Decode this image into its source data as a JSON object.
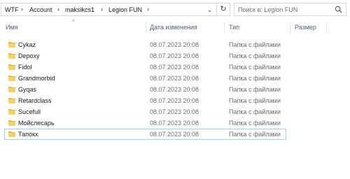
{
  "address_bar": {
    "crumbs": [
      "WTF",
      "Account",
      "maksikcs1",
      "Legion FUN"
    ]
  },
  "search": {
    "placeholder": "Поиск в: Legion FUN"
  },
  "columns": {
    "name": "Имя",
    "date": "Дата изменения",
    "type": "Тип",
    "size": "Размер"
  },
  "sorted_column": "name",
  "rows": [
    {
      "name": "Cykaz",
      "date": "08.07.2023 20:08",
      "type": "Папка с файлами",
      "size": ""
    },
    {
      "name": "Depoxy",
      "date": "08.07.2023 20:08",
      "type": "Папка с файлами",
      "size": ""
    },
    {
      "name": "Fidol",
      "date": "08.07.2023 20:08",
      "type": "Папка с файлами",
      "size": ""
    },
    {
      "name": "Grandmorbid",
      "date": "08.07.2023 20:08",
      "type": "Папка с файлами",
      "size": ""
    },
    {
      "name": "Gyqas",
      "date": "08.07.2023 20:08",
      "type": "Папка с файлами",
      "size": ""
    },
    {
      "name": "Retardclass",
      "date": "08.07.2023 20:08",
      "type": "Папка с файлами",
      "size": ""
    },
    {
      "name": "Sucefull",
      "date": "08.07.2023 20:08",
      "type": "Папка с файлами",
      "size": ""
    },
    {
      "name": "Мойслесарь",
      "date": "08.07.2023 20:08",
      "type": "Папка с файлами",
      "size": ""
    },
    {
      "name": "Тапокх",
      "date": "08.07.2023 20:08",
      "type": "Папка с файлами",
      "size": ""
    }
  ],
  "selected_row": "Тапокх",
  "colors": {
    "folder": "#f7d063",
    "folder_back": "#e8b442",
    "header_text": "#4d6082",
    "selection_border": "#99d1ff",
    "secondary_text": "#6d6d6d"
  },
  "icons": {
    "folder": "folder-icon",
    "search": "search-icon",
    "refresh": "refresh-icon",
    "breadcrumb_separator": "chevron-right-icon",
    "history": "chevron-down-icon",
    "sort": "sort-up-icon"
  }
}
